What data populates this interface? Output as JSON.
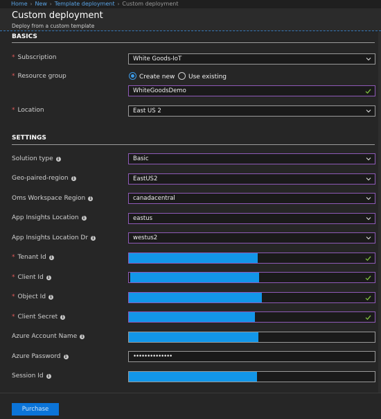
{
  "breadcrumb": {
    "items": [
      "Home",
      "New",
      "Template deployment"
    ],
    "current": "Custom deployment"
  },
  "header": {
    "title": "Custom deployment",
    "subtitle": "Deploy from a custom template"
  },
  "basics": {
    "section_title": "BASICS",
    "subscription": {
      "label": "Subscription",
      "value": "White Goods-IoT"
    },
    "resource_group": {
      "label": "Resource group",
      "option_new": "Create new",
      "option_existing": "Use existing",
      "selected": "Create new",
      "value": "WhiteGoodsDemo"
    },
    "location": {
      "label": "Location",
      "value": "East US 2"
    }
  },
  "settings": {
    "section_title": "SETTINGS",
    "solution_type": {
      "label": "Solution type",
      "value": "Basic"
    },
    "geo_paired_region": {
      "label": "Geo-paired-region",
      "value": "EastUS2"
    },
    "oms_workspace_region": {
      "label": "Oms Workspace Region",
      "value": "canadacentral"
    },
    "app_insights_location": {
      "label": "App Insights Location",
      "value": "eastus"
    },
    "app_insights_location_dr": {
      "label": "App Insights Location Dr",
      "value": "westus2"
    },
    "tenant_id": {
      "label": "Tenant Id"
    },
    "client_id": {
      "label": "Client Id"
    },
    "object_id": {
      "label": "Object Id"
    },
    "client_secret": {
      "label": "Client Secret"
    },
    "azure_account_name": {
      "label": "Azure Account Name"
    },
    "azure_password": {
      "label": "Azure Password",
      "value": "••••••••••••••"
    },
    "session_id": {
      "label": "Session Id"
    }
  },
  "footer": {
    "purchase_label": "Purchase"
  },
  "colors": {
    "accent": "#0b74d8",
    "redaction": "#1296e8",
    "valid_border": "#8f5ab8",
    "required": "#e05a5a",
    "check": "#7fbf3f"
  }
}
